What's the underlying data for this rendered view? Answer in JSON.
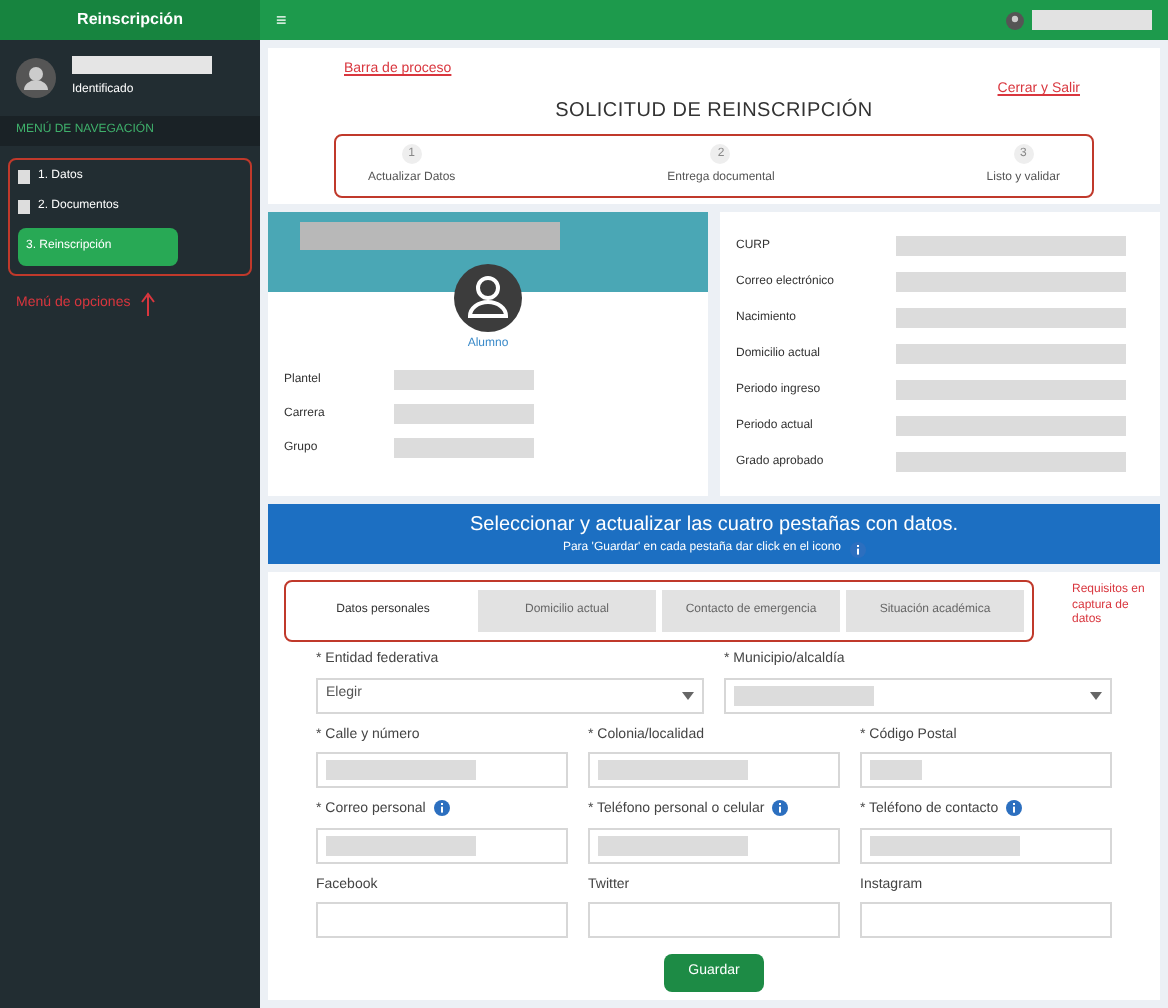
{
  "header": {
    "brand": "Reinscripción",
    "menu_icon": "≡"
  },
  "sidebar": {
    "user_status": "Identificado",
    "section": "MENÚ DE NAVEGACIÓN",
    "items": [
      {
        "label": "1. Datos",
        "kind": "link"
      },
      {
        "label": "2. Documentos",
        "kind": "link"
      },
      {
        "label": "3. Reinscripción",
        "kind": "button"
      }
    ]
  },
  "annotations": {
    "menu": "Menú de opciones",
    "steps": "Barra de proceso",
    "logout": "Cerrar y Salir",
    "tabs": "Requisitos en captura de datos"
  },
  "title": "SOLICITUD DE REINSCRIPCIÓN",
  "steps": [
    {
      "number": "1",
      "label": "Actualizar Datos"
    },
    {
      "number": "2",
      "label": "Entrega documental"
    },
    {
      "number": "3",
      "label": "Listo y validar"
    }
  ],
  "profile": {
    "role": "Alumno",
    "fields": [
      "Plantel",
      "Carrera",
      "Grupo"
    ]
  },
  "details": [
    "CURP",
    "Correo electrónico",
    "Nacimiento",
    "Domicilio actual",
    "Periodo ingreso",
    "Periodo actual",
    "Grado aprobado"
  ],
  "banner": {
    "title": "Seleccionar y actualizar las cuatro pestañas con datos.",
    "note": "Para 'Guardar' en cada pestaña dar click en el icono"
  },
  "tabs": [
    {
      "label": "Datos personales",
      "selected": true
    },
    {
      "label": "Domicilio actual",
      "selected": false
    },
    {
      "label": "Contacto de emergencia",
      "selected": false
    },
    {
      "label": "Situación académica",
      "selected": false
    }
  ],
  "form": {
    "rows": [
      [
        {
          "label": "* Entidad federativa",
          "kind": "select",
          "value": "Elegir",
          "info": false
        },
        {
          "label": "* Municipio/alcaldía",
          "kind": "select",
          "info": false
        }
      ],
      [
        {
          "label": "* Calle y número",
          "kind": "text",
          "info": false
        },
        {
          "label": "* Colonia/localidad",
          "kind": "text",
          "info": false
        },
        {
          "label": "* Código Postal",
          "kind": "short",
          "info": false
        }
      ],
      [
        {
          "label": "* Correo personal",
          "kind": "text",
          "info": true
        },
        {
          "label": "* Teléfono personal o celular",
          "kind": "text",
          "info": true
        },
        {
          "label": "* Teléfono de contacto",
          "kind": "text",
          "info": true
        }
      ],
      [
        {
          "label": "Facebook",
          "kind": "empty",
          "info": false
        },
        {
          "label": "Twitter",
          "kind": "empty",
          "info": false
        },
        {
          "label": "Instagram",
          "kind": "empty",
          "info": false
        }
      ]
    ],
    "submit": "Guardar"
  }
}
